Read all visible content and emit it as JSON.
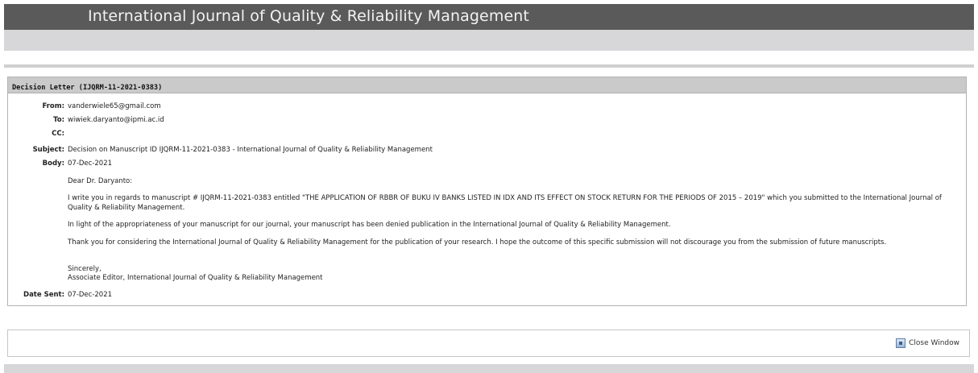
{
  "header": {
    "title": "International Journal of Quality & Reliability Management"
  },
  "panel": {
    "title": "Decision Letter (IJQRM-11-2021-0383)",
    "from_label": "From:",
    "from": "vanderwiele65@gmail.com",
    "to_label": "To:",
    "to": "wiwiek.daryanto@ipmi.ac.id",
    "cc_label": "CC:",
    "cc": "",
    "subject_label": "Subject:",
    "subject": "Decision on Manuscript ID IJQRM-11-2021-0383 - International Journal of Quality & Reliability Management",
    "body_label": "Body:",
    "body_date": "07-Dec-2021",
    "greeting": "Dear Dr. Daryanto:",
    "para1": "I write you in regards to manuscript # IJQRM-11-2021-0383 entitled \"THE APPLICATION OF RBBR OF BUKU IV BANKS LISTED IN IDX AND ITS EFFECT ON STOCK RETURN FOR THE PERIODS OF 2015 – 2019\" which you submitted to the International Journal of Quality & Reliability Management.",
    "para2": "In light of the appropriateness of your manuscript for our journal, your manuscript has been denied publication in the International Journal of Quality & Reliability Management.",
    "para3": "Thank you for considering the International Journal of Quality & Reliability Management for the publication of your research.  I hope the outcome of this specific submission will not discourage you from the submission of future manuscripts.",
    "closing": "Sincerely,",
    "signature": "Associate Editor, International Journal of Quality & Reliability Management",
    "date_sent_label": "Date Sent:",
    "date_sent": "07-Dec-2021"
  },
  "footer": {
    "close_label": "Close Window",
    "close_icon": "window-icon"
  }
}
